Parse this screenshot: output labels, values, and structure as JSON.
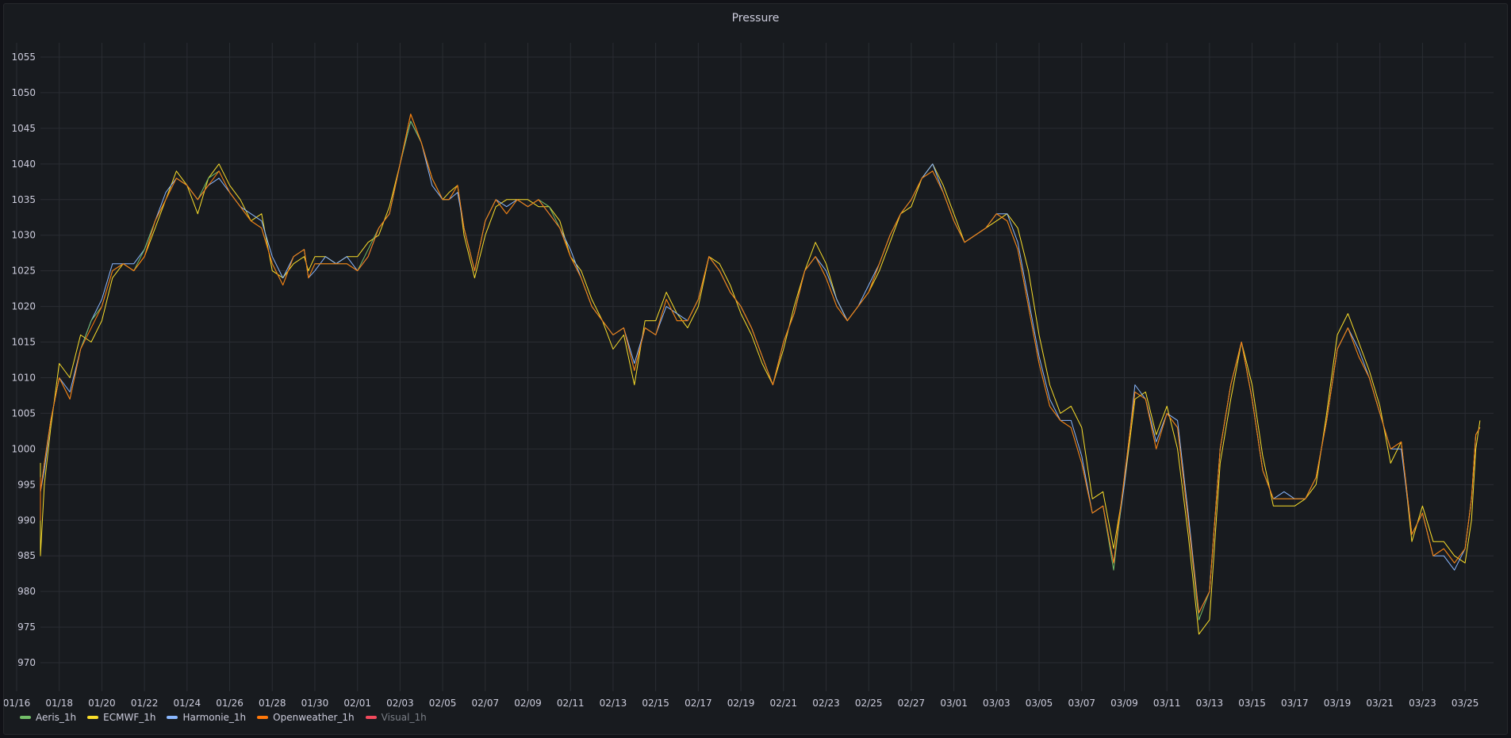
{
  "chart_data": {
    "type": "line",
    "title": "Pressure",
    "ylim": [
      966,
      1057
    ],
    "yticks": [
      1055,
      1050,
      1045,
      1040,
      1035,
      1030,
      1025,
      1020,
      1015,
      1010,
      1005,
      1000,
      995,
      990,
      985,
      980,
      975,
      970
    ],
    "xlim": [
      0,
      69
    ],
    "xticks": [
      {
        "label": "01/16",
        "x": 0
      },
      {
        "label": "01/18",
        "x": 2
      },
      {
        "label": "01/20",
        "x": 4
      },
      {
        "label": "01/22",
        "x": 6
      },
      {
        "label": "01/24",
        "x": 8
      },
      {
        "label": "01/26",
        "x": 10
      },
      {
        "label": "01/28",
        "x": 12
      },
      {
        "label": "01/30",
        "x": 14
      },
      {
        "label": "02/01",
        "x": 16
      },
      {
        "label": "02/03",
        "x": 18
      },
      {
        "label": "02/05",
        "x": 20
      },
      {
        "label": "02/07",
        "x": 22
      },
      {
        "label": "02/09",
        "x": 24
      },
      {
        "label": "02/11",
        "x": 26
      },
      {
        "label": "02/13",
        "x": 28
      },
      {
        "label": "02/15",
        "x": 30
      },
      {
        "label": "02/17",
        "x": 32
      },
      {
        "label": "02/19",
        "x": 34
      },
      {
        "label": "02/21",
        "x": 36
      },
      {
        "label": "02/23",
        "x": 38
      },
      {
        "label": "02/25",
        "x": 40
      },
      {
        "label": "02/27",
        "x": 42
      },
      {
        "label": "03/01",
        "x": 44
      },
      {
        "label": "03/03",
        "x": 46
      },
      {
        "label": "03/05",
        "x": 48
      },
      {
        "label": "03/07",
        "x": 50
      },
      {
        "label": "03/09",
        "x": 52
      },
      {
        "label": "03/11",
        "x": 54
      },
      {
        "label": "03/13",
        "x": 56
      },
      {
        "label": "03/15",
        "x": 58
      },
      {
        "label": "03/17",
        "x": 60
      },
      {
        "label": "03/19",
        "x": 62
      },
      {
        "label": "03/21",
        "x": 64
      },
      {
        "label": "03/23",
        "x": 66
      },
      {
        "label": "03/25",
        "x": 68
      }
    ],
    "grid": true,
    "legend_position": "bottom-left",
    "x": [
      -0.6,
      -0.3,
      0,
      0.4,
      0.7,
      1.0,
      1.3,
      1.6,
      2.0,
      2.5,
      3.0,
      3.5,
      4.0,
      4.5,
      5.0,
      5.5,
      6.0,
      6.5,
      7.0,
      7.5,
      8.0,
      8.5,
      9.0,
      9.5,
      10.0,
      10.5,
      11.0,
      11.5,
      12.0,
      12.5,
      13.0,
      13.5,
      13.7,
      14.0,
      14.5,
      15.0,
      15.5,
      16.0,
      16.5,
      17.0,
      17.5,
      18.0,
      18.5,
      19.0,
      19.5,
      20.0,
      20.3,
      20.7,
      21.0,
      21.5,
      22.0,
      22.5,
      23.0,
      23.5,
      24.0,
      24.5,
      25.0,
      25.5,
      26.0,
      26.5,
      27.0,
      27.5,
      28.0,
      28.5,
      29.0,
      29.5,
      30.0,
      30.5,
      31.0,
      31.5,
      32.0,
      32.5,
      33.0,
      33.5,
      34.0,
      34.5,
      35.0,
      35.5,
      36.0,
      36.5,
      37.0,
      37.5,
      38.0,
      38.5,
      39.0,
      39.5,
      40.0,
      40.5,
      41.0,
      41.5,
      42.0,
      42.5,
      43.0,
      43.5,
      44.0,
      44.5,
      45.0,
      45.5,
      46.0,
      46.5,
      47.0,
      47.5,
      48.0,
      48.5,
      49.0,
      49.5,
      50.0,
      50.5,
      51.0,
      51.5,
      52.0,
      52.5,
      53.0,
      53.5,
      54.0,
      54.5,
      55.0,
      55.5,
      56.0,
      56.5,
      57.0,
      57.5,
      58.0,
      58.5,
      59.0,
      59.5,
      60.0,
      60.5,
      61.0,
      61.5,
      62.0,
      62.5,
      63.0,
      63.5,
      64.0,
      64.5,
      65.0,
      65.5,
      66.0,
      66.5,
      67.0,
      67.5,
      68.0,
      68.3,
      68.5,
      68.7
    ],
    "series": [
      {
        "name": "Aeris_1h",
        "color": "#73bf69",
        "visible": true,
        "values": [
          995,
          993,
          996,
          990,
          990,
          994,
          998,
          1004,
          1010,
          1007,
          1014,
          1018,
          1020,
          1025,
          1026,
          1025,
          1028,
          1032,
          1035,
          1038,
          1037,
          1035,
          1038,
          1039,
          1036,
          1034,
          1032,
          1031,
          1026,
          1023,
          1027,
          1028,
          1024,
          1026,
          1026,
          1026,
          1026,
          1025,
          1028,
          1031,
          1033,
          1040,
          1046,
          1043,
          1038,
          1035,
          1035,
          1037,
          1031,
          1025,
          1032,
          1035,
          1033,
          1035,
          1034,
          1035,
          1034,
          1031,
          1027,
          1024,
          1020,
          1018,
          1016,
          1017,
          1011,
          1017,
          1016,
          1021,
          1018,
          1018,
          1021,
          1027,
          1025,
          1022,
          1020,
          1017,
          1013,
          1009,
          1015,
          1019,
          1025,
          1027,
          1024,
          1020,
          1018,
          1020,
          1022,
          1026,
          1030,
          1033,
          1035,
          1038,
          1039,
          1036,
          1032,
          1029,
          1030,
          1031,
          1033,
          1032,
          1028,
          1020,
          1012,
          1006,
          1004,
          1003,
          998,
          991,
          992,
          983,
          996,
          1008,
          1007,
          1000,
          1005,
          1003,
          990,
          976,
          980,
          1000,
          1009,
          1015,
          1007,
          997,
          993,
          993,
          993,
          993,
          996,
          1004,
          1014,
          1017,
          1013,
          1010,
          1005,
          1000,
          1001,
          988,
          991,
          985,
          986,
          984,
          986,
          993,
          1002,
          1003,
          1002
        ]
      },
      {
        "name": "ECMWF_1h",
        "color": "#fade2a",
        "visible": true,
        "values": [
          997,
          996,
          998,
          990,
          989,
          985,
          995,
          1003,
          1012,
          1010,
          1016,
          1015,
          1018,
          1024,
          1026,
          1025,
          1027,
          1031,
          1035,
          1039,
          1037,
          1033,
          1038,
          1040,
          1037,
          1035,
          1032,
          1033,
          1025,
          1024,
          1026,
          1027,
          1025,
          1027,
          1027,
          1026,
          1027,
          1027,
          1029,
          1030,
          1034,
          1040,
          1047,
          1043,
          1038,
          1035,
          1036,
          1037,
          1030,
          1024,
          1030,
          1034,
          1035,
          1035,
          1035,
          1034,
          1034,
          1032,
          1027,
          1025,
          1021,
          1018,
          1014,
          1016,
          1009,
          1018,
          1018,
          1022,
          1019,
          1017,
          1020,
          1027,
          1026,
          1023,
          1019,
          1016,
          1012,
          1009,
          1014,
          1020,
          1025,
          1029,
          1026,
          1021,
          1018,
          1020,
          1022,
          1025,
          1029,
          1033,
          1034,
          1038,
          1040,
          1037,
          1033,
          1029,
          1030,
          1031,
          1032,
          1033,
          1031,
          1025,
          1016,
          1009,
          1005,
          1006,
          1003,
          993,
          994,
          986,
          995,
          1007,
          1008,
          1002,
          1006,
          1000,
          988,
          974,
          976,
          998,
          1007,
          1015,
          1009,
          999,
          992,
          992,
          992,
          993,
          995,
          1005,
          1016,
          1019,
          1015,
          1011,
          1006,
          998,
          1001,
          987,
          992,
          987,
          987,
          985,
          984,
          990,
          1000,
          1004,
          1003
        ]
      },
      {
        "name": "Harmonie_1h",
        "color": "#8ab8ff",
        "visible": true,
        "values": [
          995,
          994,
          996,
          991,
          991,
          994,
          997,
          1004,
          1010,
          1008,
          1014,
          1018,
          1021,
          1026,
          1026,
          1026,
          1028,
          1032,
          1036,
          1038,
          1037,
          1035,
          1037,
          1038,
          1036,
          1034,
          1033,
          1032,
          1027,
          1024,
          1027,
          1028,
          1024,
          1025,
          1027,
          1026,
          1027,
          1025,
          1027,
          1031,
          1033,
          1040,
          1046,
          1043,
          1037,
          1035,
          1035,
          1036,
          1031,
          1025,
          1032,
          1035,
          1034,
          1035,
          1034,
          1035,
          1033,
          1031,
          1028,
          1024,
          1020,
          1018,
          1016,
          1017,
          1012,
          1017,
          1016,
          1020,
          1019,
          1018,
          1021,
          1027,
          1025,
          1022,
          1020,
          1017,
          1013,
          1009,
          1015,
          1019,
          1025,
          1027,
          1025,
          1021,
          1018,
          1020,
          1023,
          1026,
          1030,
          1033,
          1035,
          1038,
          1040,
          1036,
          1032,
          1029,
          1030,
          1031,
          1033,
          1033,
          1029,
          1021,
          1013,
          1007,
          1004,
          1004,
          999,
          991,
          992,
          984,
          995,
          1009,
          1007,
          1001,
          1005,
          1004,
          991,
          977,
          980,
          1000,
          1009,
          1015,
          1007,
          997,
          993,
          994,
          993,
          993,
          996,
          1004,
          1014,
          1017,
          1014,
          1010,
          1005,
          1000,
          1000,
          988,
          991,
          985,
          985,
          983,
          986,
          993,
          1002,
          1003,
          1002
        ]
      },
      {
        "name": "Openweather_1h",
        "color": "#ff780a",
        "visible": true,
        "values": [
          994,
          993,
          996,
          990,
          990,
          994,
          998,
          1004,
          1010,
          1007,
          1014,
          1017,
          1020,
          1025,
          1026,
          1025,
          1027,
          1032,
          1035,
          1038,
          1037,
          1035,
          1037,
          1039,
          1036,
          1034,
          1032,
          1031,
          1026,
          1023,
          1027,
          1028,
          1024,
          1026,
          1026,
          1026,
          1026,
          1025,
          1027,
          1031,
          1033,
          1040,
          1047,
          1043,
          1038,
          1035,
          1035,
          1037,
          1031,
          1025,
          1032,
          1035,
          1033,
          1035,
          1034,
          1035,
          1033,
          1031,
          1027,
          1024,
          1020,
          1018,
          1016,
          1017,
          1011,
          1017,
          1016,
          1021,
          1018,
          1018,
          1021,
          1027,
          1025,
          1022,
          1020,
          1017,
          1013,
          1009,
          1015,
          1019,
          1025,
          1027,
          1024,
          1020,
          1018,
          1020,
          1022,
          1026,
          1030,
          1033,
          1035,
          1038,
          1039,
          1036,
          1032,
          1029,
          1030,
          1031,
          1033,
          1032,
          1028,
          1020,
          1012,
          1006,
          1004,
          1003,
          998,
          991,
          992,
          984,
          996,
          1008,
          1007,
          1000,
          1005,
          1003,
          990,
          977,
          980,
          1000,
          1009,
          1015,
          1007,
          997,
          993,
          993,
          993,
          993,
          996,
          1004,
          1014,
          1017,
          1013,
          1010,
          1005,
          1000,
          1001,
          988,
          991,
          985,
          986,
          984,
          986,
          993,
          1002,
          1003,
          1002
        ]
      },
      {
        "name": "Visual_1h",
        "color": "#f2495c",
        "visible": false,
        "values": []
      }
    ]
  }
}
